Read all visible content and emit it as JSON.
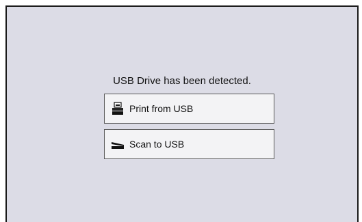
{
  "dialog": {
    "message": "USB Drive has been detected.",
    "options": [
      {
        "label": "Print from USB",
        "icon": "printer-icon"
      },
      {
        "label": "Scan to USB",
        "icon": "scanner-icon"
      }
    ]
  },
  "colors": {
    "background": "#dcdce6",
    "button": "#f3f3f5",
    "border": "#1a1a1a"
  }
}
